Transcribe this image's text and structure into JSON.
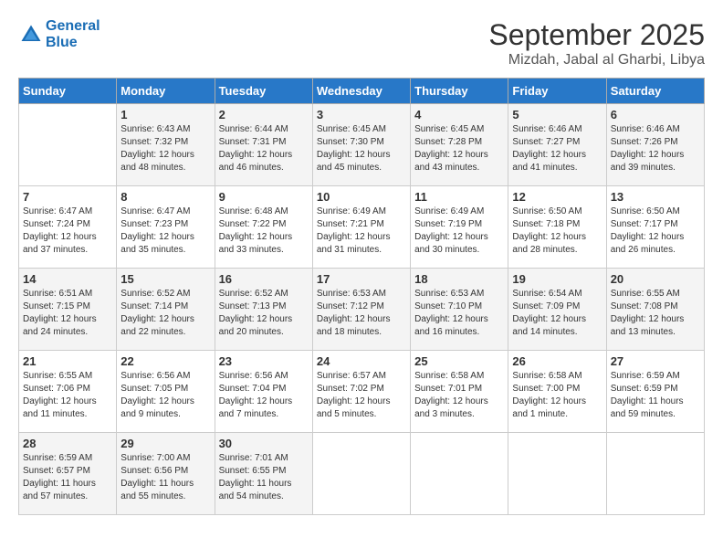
{
  "header": {
    "logo_line1": "General",
    "logo_line2": "Blue",
    "month": "September 2025",
    "location": "Mizdah, Jabal al Gharbi, Libya"
  },
  "days_of_week": [
    "Sunday",
    "Monday",
    "Tuesday",
    "Wednesday",
    "Thursday",
    "Friday",
    "Saturday"
  ],
  "weeks": [
    [
      {
        "day": "",
        "sunrise": "",
        "sunset": "",
        "daylight": ""
      },
      {
        "day": "1",
        "sunrise": "Sunrise: 6:43 AM",
        "sunset": "Sunset: 7:32 PM",
        "daylight": "Daylight: 12 hours and 48 minutes."
      },
      {
        "day": "2",
        "sunrise": "Sunrise: 6:44 AM",
        "sunset": "Sunset: 7:31 PM",
        "daylight": "Daylight: 12 hours and 46 minutes."
      },
      {
        "day": "3",
        "sunrise": "Sunrise: 6:45 AM",
        "sunset": "Sunset: 7:30 PM",
        "daylight": "Daylight: 12 hours and 45 minutes."
      },
      {
        "day": "4",
        "sunrise": "Sunrise: 6:45 AM",
        "sunset": "Sunset: 7:28 PM",
        "daylight": "Daylight: 12 hours and 43 minutes."
      },
      {
        "day": "5",
        "sunrise": "Sunrise: 6:46 AM",
        "sunset": "Sunset: 7:27 PM",
        "daylight": "Daylight: 12 hours and 41 minutes."
      },
      {
        "day": "6",
        "sunrise": "Sunrise: 6:46 AM",
        "sunset": "Sunset: 7:26 PM",
        "daylight": "Daylight: 12 hours and 39 minutes."
      }
    ],
    [
      {
        "day": "7",
        "sunrise": "Sunrise: 6:47 AM",
        "sunset": "Sunset: 7:24 PM",
        "daylight": "Daylight: 12 hours and 37 minutes."
      },
      {
        "day": "8",
        "sunrise": "Sunrise: 6:47 AM",
        "sunset": "Sunset: 7:23 PM",
        "daylight": "Daylight: 12 hours and 35 minutes."
      },
      {
        "day": "9",
        "sunrise": "Sunrise: 6:48 AM",
        "sunset": "Sunset: 7:22 PM",
        "daylight": "Daylight: 12 hours and 33 minutes."
      },
      {
        "day": "10",
        "sunrise": "Sunrise: 6:49 AM",
        "sunset": "Sunset: 7:21 PM",
        "daylight": "Daylight: 12 hours and 31 minutes."
      },
      {
        "day": "11",
        "sunrise": "Sunrise: 6:49 AM",
        "sunset": "Sunset: 7:19 PM",
        "daylight": "Daylight: 12 hours and 30 minutes."
      },
      {
        "day": "12",
        "sunrise": "Sunrise: 6:50 AM",
        "sunset": "Sunset: 7:18 PM",
        "daylight": "Daylight: 12 hours and 28 minutes."
      },
      {
        "day": "13",
        "sunrise": "Sunrise: 6:50 AM",
        "sunset": "Sunset: 7:17 PM",
        "daylight": "Daylight: 12 hours and 26 minutes."
      }
    ],
    [
      {
        "day": "14",
        "sunrise": "Sunrise: 6:51 AM",
        "sunset": "Sunset: 7:15 PM",
        "daylight": "Daylight: 12 hours and 24 minutes."
      },
      {
        "day": "15",
        "sunrise": "Sunrise: 6:52 AM",
        "sunset": "Sunset: 7:14 PM",
        "daylight": "Daylight: 12 hours and 22 minutes."
      },
      {
        "day": "16",
        "sunrise": "Sunrise: 6:52 AM",
        "sunset": "Sunset: 7:13 PM",
        "daylight": "Daylight: 12 hours and 20 minutes."
      },
      {
        "day": "17",
        "sunrise": "Sunrise: 6:53 AM",
        "sunset": "Sunset: 7:12 PM",
        "daylight": "Daylight: 12 hours and 18 minutes."
      },
      {
        "day": "18",
        "sunrise": "Sunrise: 6:53 AM",
        "sunset": "Sunset: 7:10 PM",
        "daylight": "Daylight: 12 hours and 16 minutes."
      },
      {
        "day": "19",
        "sunrise": "Sunrise: 6:54 AM",
        "sunset": "Sunset: 7:09 PM",
        "daylight": "Daylight: 12 hours and 14 minutes."
      },
      {
        "day": "20",
        "sunrise": "Sunrise: 6:55 AM",
        "sunset": "Sunset: 7:08 PM",
        "daylight": "Daylight: 12 hours and 13 minutes."
      }
    ],
    [
      {
        "day": "21",
        "sunrise": "Sunrise: 6:55 AM",
        "sunset": "Sunset: 7:06 PM",
        "daylight": "Daylight: 12 hours and 11 minutes."
      },
      {
        "day": "22",
        "sunrise": "Sunrise: 6:56 AM",
        "sunset": "Sunset: 7:05 PM",
        "daylight": "Daylight: 12 hours and 9 minutes."
      },
      {
        "day": "23",
        "sunrise": "Sunrise: 6:56 AM",
        "sunset": "Sunset: 7:04 PM",
        "daylight": "Daylight: 12 hours and 7 minutes."
      },
      {
        "day": "24",
        "sunrise": "Sunrise: 6:57 AM",
        "sunset": "Sunset: 7:02 PM",
        "daylight": "Daylight: 12 hours and 5 minutes."
      },
      {
        "day": "25",
        "sunrise": "Sunrise: 6:58 AM",
        "sunset": "Sunset: 7:01 PM",
        "daylight": "Daylight: 12 hours and 3 minutes."
      },
      {
        "day": "26",
        "sunrise": "Sunrise: 6:58 AM",
        "sunset": "Sunset: 7:00 PM",
        "daylight": "Daylight: 12 hours and 1 minute."
      },
      {
        "day": "27",
        "sunrise": "Sunrise: 6:59 AM",
        "sunset": "Sunset: 6:59 PM",
        "daylight": "Daylight: 11 hours and 59 minutes."
      }
    ],
    [
      {
        "day": "28",
        "sunrise": "Sunrise: 6:59 AM",
        "sunset": "Sunset: 6:57 PM",
        "daylight": "Daylight: 11 hours and 57 minutes."
      },
      {
        "day": "29",
        "sunrise": "Sunrise: 7:00 AM",
        "sunset": "Sunset: 6:56 PM",
        "daylight": "Daylight: 11 hours and 55 minutes."
      },
      {
        "day": "30",
        "sunrise": "Sunrise: 7:01 AM",
        "sunset": "Sunset: 6:55 PM",
        "daylight": "Daylight: 11 hours and 54 minutes."
      },
      {
        "day": "",
        "sunrise": "",
        "sunset": "",
        "daylight": ""
      },
      {
        "day": "",
        "sunrise": "",
        "sunset": "",
        "daylight": ""
      },
      {
        "day": "",
        "sunrise": "",
        "sunset": "",
        "daylight": ""
      },
      {
        "day": "",
        "sunrise": "",
        "sunset": "",
        "daylight": ""
      }
    ]
  ]
}
